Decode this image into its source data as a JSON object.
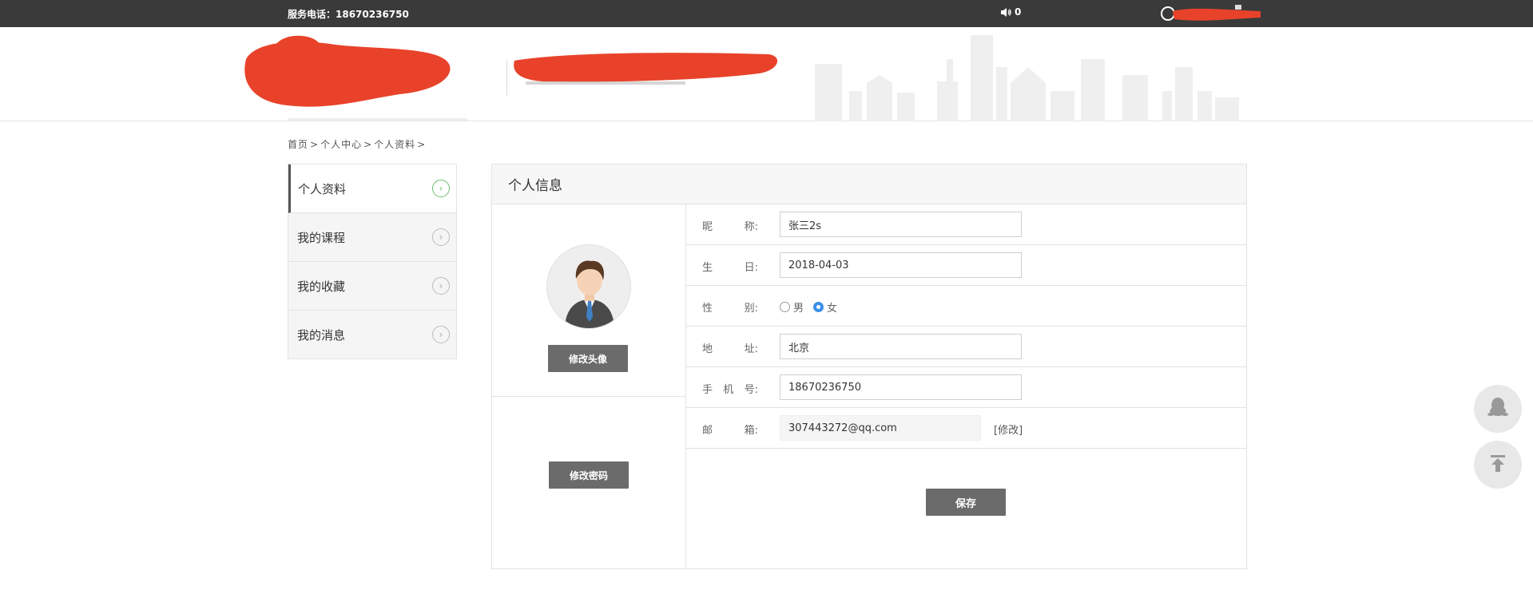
{
  "topbar": {
    "phone": "服务电话：18670236750",
    "message_count": "0"
  },
  "breadcrumb": [
    "首页",
    ">",
    "个人中心",
    ">",
    "个人资料",
    ">"
  ],
  "sidebar": {
    "items": [
      {
        "label": "个人资料",
        "active": true
      },
      {
        "label": "我的课程",
        "active": false
      },
      {
        "label": "我的收藏",
        "active": false
      },
      {
        "label": "我的消息",
        "active": false
      }
    ],
    "arrow_glyph": "›"
  },
  "panel": {
    "title": "个人信息",
    "change_avatar": "修改头像",
    "change_password": "修改密码",
    "save": "保存"
  },
  "form": {
    "nickname": {
      "label_a": "昵",
      "label_b": "称:",
      "value": "张三2s"
    },
    "birthday": {
      "label_a": "生",
      "label_b": "日:",
      "value": "2018-04-03"
    },
    "gender": {
      "label_a": "性",
      "label_b": "别:",
      "options": [
        "男",
        "女"
      ],
      "selected": "女"
    },
    "address": {
      "label_a": "地",
      "label_b": "址:",
      "value": "北京"
    },
    "mobile": {
      "label_a": "手",
      "label_m": "机",
      "label_b": "号:",
      "value": "18670236750"
    },
    "email": {
      "label_a": "邮",
      "label_b": "箱:",
      "value": "307443272@qq.com",
      "modify": "[修改]"
    }
  },
  "colors": {
    "topbar": "#3a3a3a",
    "redaction": "#e8432a",
    "button": "#6b6b6b",
    "radio_selected": "#3b8fe6",
    "active_arrow": "#6cbf6c"
  }
}
